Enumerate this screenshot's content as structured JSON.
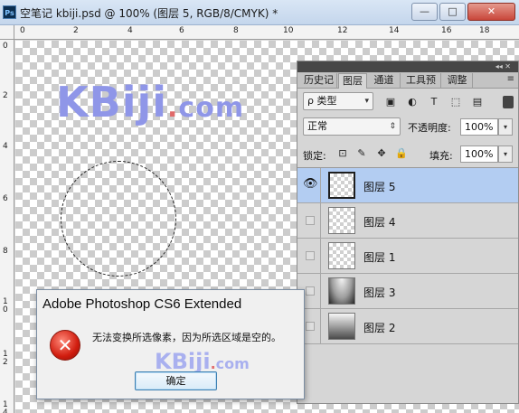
{
  "titlebar": {
    "app_badge": "Ps",
    "title": "空笔记   kbiji.psd @ 100% (图层 5, RGB/8/CMYK) *",
    "minimize_glyph": "—",
    "maximize_glyph": "□",
    "close_glyph": "✕"
  },
  "ruler": {
    "top_labels": [
      "0",
      "2",
      "4",
      "6",
      "8",
      "10",
      "12",
      "14",
      "16",
      "18"
    ],
    "left_labels": [
      "0",
      "2",
      "4",
      "6",
      "8",
      "1\n0",
      "1\n2",
      "1\n4"
    ]
  },
  "canvas": {
    "logo_main": "KBiji",
    "logo_dot": ".",
    "logo_com": "com"
  },
  "panel": {
    "tabs": [
      "历史记",
      "图层",
      "通道",
      "工具预",
      "调整"
    ],
    "active_tab": "图层",
    "menu_glyph": "≡",
    "filter_select": "ρ 类型",
    "filter_icons": [
      "▣",
      "◐",
      "T",
      "⬚",
      "▤"
    ],
    "blend_mode": "正常",
    "opacity_label": "不透明度:",
    "opacity_value": "100%",
    "lock_label": "锁定:",
    "lock_icons": [
      "⊡",
      "✎",
      "✥",
      "🔒"
    ],
    "fill_label": "填充:",
    "fill_value": "100%",
    "layers": [
      {
        "name": "图层 5",
        "visible": true,
        "selected": true
      },
      {
        "name": "图层 4",
        "visible": false,
        "selected": false
      },
      {
        "name": "图层 1",
        "visible": false,
        "selected": false
      },
      {
        "name": "图层 3",
        "visible": false,
        "selected": false
      },
      {
        "name": "图层 2",
        "visible": false,
        "selected": false
      }
    ]
  },
  "dialog": {
    "title": "Adobe Photoshop CS6 Extended",
    "error_glyph": "✕",
    "message": "无法变换所选像素，因为所选区域是空的。",
    "watermark_main": "KBiji",
    "watermark_dot": ".",
    "watermark_com": "com",
    "ok_label": "确定"
  }
}
